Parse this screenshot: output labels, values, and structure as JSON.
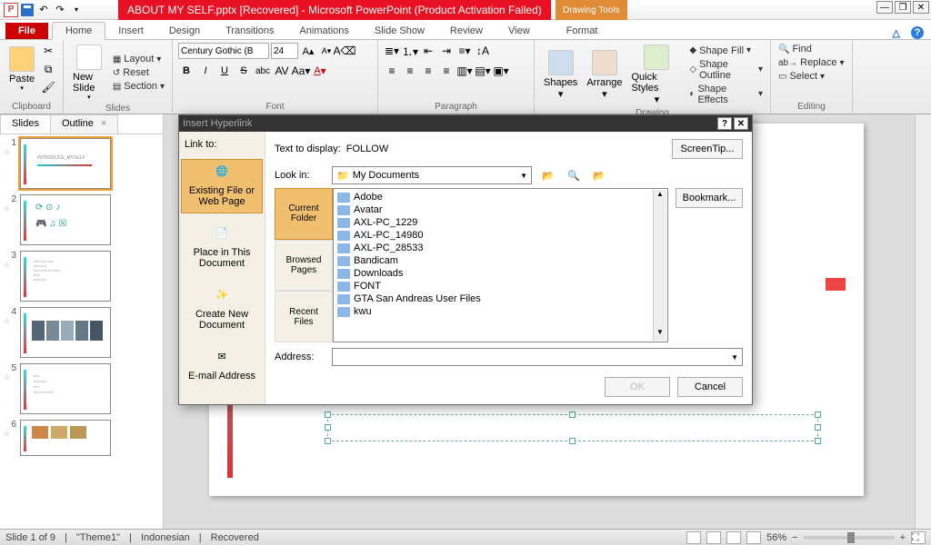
{
  "title": "ABOUT MY SELF.pptx [Recovered]  -  Microsoft PowerPoint (Product Activation Failed)",
  "contextTab": {
    "group": "Drawing Tools",
    "tab": "Format"
  },
  "tabs": {
    "file": "File",
    "home": "Home",
    "insert": "Insert",
    "design": "Design",
    "transitions": "Transitions",
    "animations": "Animations",
    "slideshow": "Slide Show",
    "review": "Review",
    "view": "View"
  },
  "ribbon": {
    "clipboard": "Clipboard",
    "paste": "Paste",
    "slides": "Slides",
    "newslide": "New Slide",
    "layout": "Layout",
    "reset": "Reset",
    "section": "Section",
    "font": "Font",
    "fontname": "Century Gothic (B",
    "fontsize": "24",
    "paragraph": "Paragraph",
    "drawing": "Drawing",
    "shapes": "Shapes",
    "arrange": "Arrange",
    "quickstyles": "Quick Styles",
    "shapefill": "Shape Fill",
    "shapeoutline": "Shape Outline",
    "shapeeffects": "Shape Effects",
    "editing": "Editing",
    "find": "Find",
    "replace": "Replace",
    "select": "Select"
  },
  "slidepanel": {
    "slides": "Slides",
    "outline": "Outline",
    "title1": "INTRODUCE_MYSELF"
  },
  "dialog": {
    "title": "Insert Hyperlink",
    "linkto": "Link to:",
    "textlabel": "Text to display:",
    "textvalue": "FOLLOW",
    "screentip": "ScreenTip...",
    "existing": "Existing File or Web Page",
    "placein": "Place in This Document",
    "createnew": "Create New Document",
    "email": "E-mail Address",
    "lookin": "Look in:",
    "lookval": "My Documents",
    "currentfolder": "Current Folder",
    "browsed": "Browsed Pages",
    "recent": "Recent Files",
    "bookmark": "Bookmark...",
    "address": "Address:",
    "ok": "OK",
    "cancel": "Cancel",
    "files": [
      "Adobe",
      "Avatar",
      "AXL-PC_1229",
      "AXL-PC_14980",
      "AXL-PC_28533",
      "Bandicam",
      "Downloads",
      "FONT",
      "GTA San Andreas User Files",
      "kwu"
    ]
  },
  "status": {
    "slide": "Slide 1 of 9",
    "theme": "\"Theme1\"",
    "lang": "Indonesian",
    "recov": "Recovered",
    "zoom": "56%"
  }
}
